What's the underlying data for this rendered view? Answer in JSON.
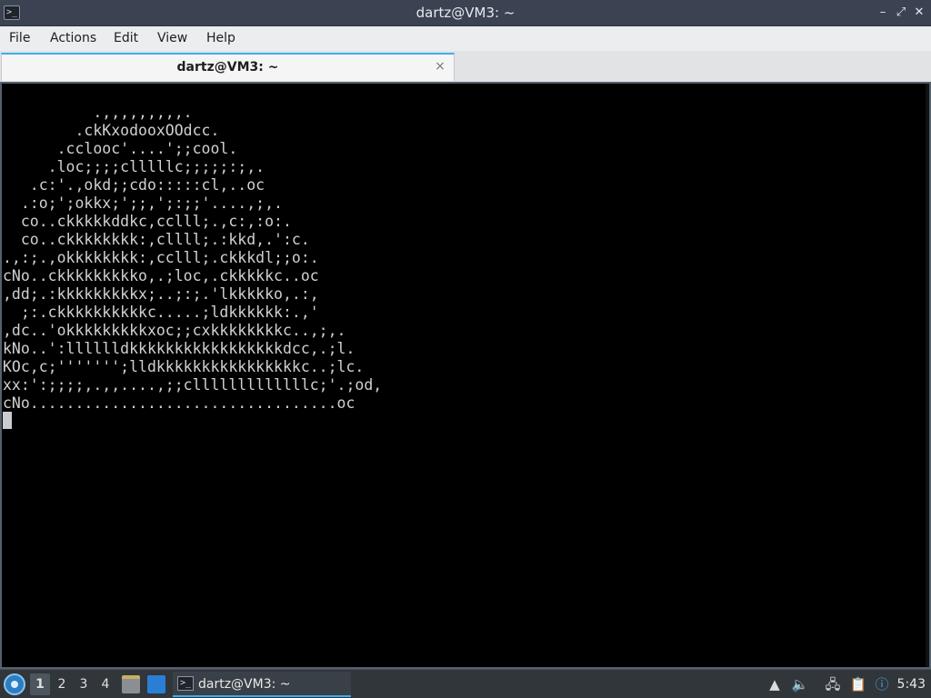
{
  "window": {
    "title": "dartz@VM3: ~",
    "minimize_glyph": "–",
    "maximize_glyph": "⤢",
    "close_glyph": "✕"
  },
  "menu": {
    "file": "File",
    "actions": "Actions",
    "edit": "Edit",
    "view": "View",
    "help": "Help"
  },
  "tabs": [
    {
      "label": "dartz@VM3: ~",
      "close_glyph": "×"
    }
  ],
  "terminal": {
    "output": "          .,,,,,,,,,.\n        .ckKxodooxOOdcc.\n      .cclooc'....';;cool.\n     .loc;;;;clllllc;;;;;:;,.\n   .c:'.,okd;;cdo:::::cl,..oc\n  .:o;';okkx;';;,';:;;'....,;,.\n  co..ckkkkkddkc,cclll;.,c:,:o:.\n  co..ckkkkkkkk:,cllll;.:kkd,.':c.\n.,:;.,okkkkkkkk:,cclll;.ckkkdl;;o:.\ncNo..ckkkkkkkkko,.;loc,.ckkkkkc..oc\n,dd;.:kkkkkkkkkx;..;:;.'lkkkkko,.:,\n  ;:.ckkkkkkkkkkc.....;ldkkkkkk:.,'\n,dc..'okkkkkkkkkxoc;;cxkkkkkkkkc..,;,.\nkNo..':lllllldkkkkkkkkkkkkkkkkkdcc,.;l.\nKOc,c;''''''';lldkkkkkkkkkkkkkkkkc..;lc.\nxx:':;;;;,.,,....,;;clllllllllllllc;'.;od,\ncNo..................................oc"
  },
  "taskbar": {
    "desktops": [
      "1",
      "2",
      "3",
      "4"
    ],
    "active_desktop": "1",
    "task_label": "dartz@VM3: ~",
    "clock": "5:43"
  },
  "icons": {
    "app": "terminal-icon",
    "start": "lxqt-start-menu-icon",
    "file_manager": "file-manager-icon",
    "show_desktop": "show-desktop-icon",
    "volume": "volume-icon",
    "network": "network-icon",
    "clipboard": "clipboard-icon",
    "notification": "notification-icon"
  },
  "colors": {
    "accent": "#3daee9",
    "terminal_bg": "#000000",
    "terminal_fg": "#d0d0d0",
    "titlebar_bg": "#3b4252",
    "taskbar_bg": "#31363b"
  }
}
